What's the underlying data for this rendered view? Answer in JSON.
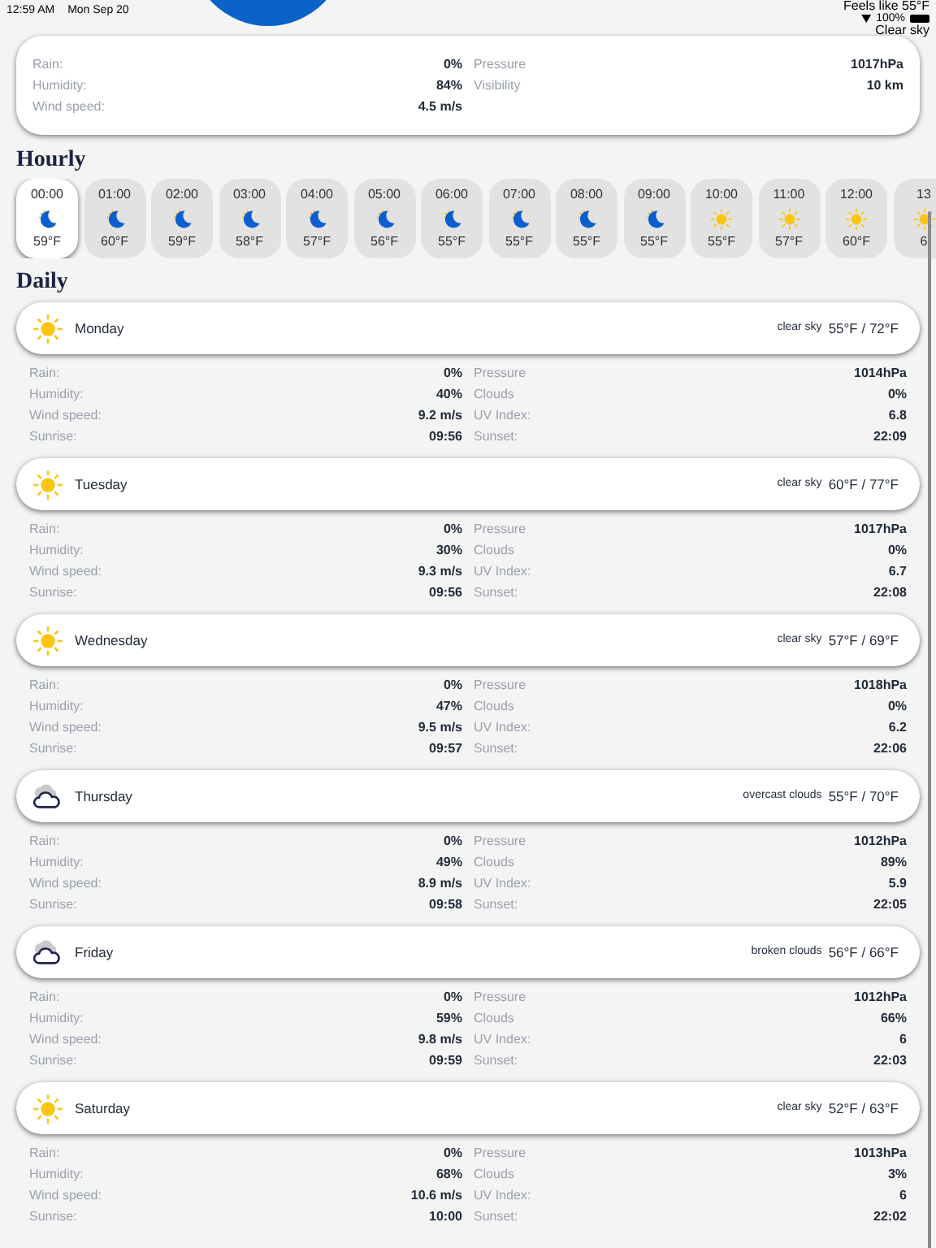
{
  "status_bar": {
    "time": "12:59 AM",
    "date": "Mon Sep 20",
    "battery": "100%"
  },
  "current": {
    "feels_like": "Feels like 55°F",
    "description": "Clear sky",
    "details_left": [
      {
        "label": "Rain:",
        "value": "0%"
      },
      {
        "label": "Humidity:",
        "value": "84%"
      },
      {
        "label": "Wind speed:",
        "value": "4.5 m/s"
      }
    ],
    "details_right": [
      {
        "label": "Pressure",
        "value": "1017hPa"
      },
      {
        "label": "Visibility",
        "value": "10 km"
      }
    ]
  },
  "hourly": {
    "title": "Hourly",
    "items": [
      {
        "time": "00:00",
        "kind": "moon",
        "temp": "59°F",
        "selected": true
      },
      {
        "time": "01:00",
        "kind": "moon",
        "temp": "60°F",
        "selected": false
      },
      {
        "time": "02:00",
        "kind": "moon",
        "temp": "59°F",
        "selected": false
      },
      {
        "time": "03:00",
        "kind": "moon",
        "temp": "58°F",
        "selected": false
      },
      {
        "time": "04:00",
        "kind": "moon",
        "temp": "57°F",
        "selected": false
      },
      {
        "time": "05:00",
        "kind": "moon",
        "temp": "56°F",
        "selected": false
      },
      {
        "time": "06:00",
        "kind": "moon",
        "temp": "55°F",
        "selected": false
      },
      {
        "time": "07:00",
        "kind": "moon",
        "temp": "55°F",
        "selected": false
      },
      {
        "time": "08:00",
        "kind": "moon",
        "temp": "55°F",
        "selected": false
      },
      {
        "time": "09:00",
        "kind": "moon",
        "temp": "55°F",
        "selected": false
      },
      {
        "time": "10:00",
        "kind": "sun",
        "temp": "55°F",
        "selected": false
      },
      {
        "time": "11:00",
        "kind": "sun",
        "temp": "57°F",
        "selected": false
      },
      {
        "time": "12:00",
        "kind": "sun",
        "temp": "60°F",
        "selected": false
      },
      {
        "time": "13",
        "kind": "sun",
        "temp": "6",
        "selected": false
      }
    ]
  },
  "daily": {
    "title": "Daily",
    "days": [
      {
        "name": "Monday",
        "kind": "sun",
        "description": "clear sky",
        "temps": "55°F / 72°F",
        "details_left": [
          {
            "label": "Rain:",
            "value": "0%"
          },
          {
            "label": "Humidity:",
            "value": "40%"
          },
          {
            "label": "Wind speed:",
            "value": "9.2 m/s"
          },
          {
            "label": "Sunrise:",
            "value": "09:56"
          }
        ],
        "details_right": [
          {
            "label": "Pressure",
            "value": "1014hPa"
          },
          {
            "label": "Clouds",
            "value": "0%"
          },
          {
            "label": "UV Index:",
            "value": "6.8"
          },
          {
            "label": "Sunset:",
            "value": "22:09"
          }
        ]
      },
      {
        "name": "Tuesday",
        "kind": "sun",
        "description": "clear sky",
        "temps": "60°F / 77°F",
        "details_left": [
          {
            "label": "Rain:",
            "value": "0%"
          },
          {
            "label": "Humidity:",
            "value": "30%"
          },
          {
            "label": "Wind speed:",
            "value": "9.3 m/s"
          },
          {
            "label": "Sunrise:",
            "value": "09:56"
          }
        ],
        "details_right": [
          {
            "label": "Pressure",
            "value": "1017hPa"
          },
          {
            "label": "Clouds",
            "value": "0%"
          },
          {
            "label": "UV Index:",
            "value": "6.7"
          },
          {
            "label": "Sunset:",
            "value": "22:08"
          }
        ]
      },
      {
        "name": "Wednesday",
        "kind": "sun",
        "description": "clear sky",
        "temps": "57°F / 69°F",
        "details_left": [
          {
            "label": "Rain:",
            "value": "0%"
          },
          {
            "label": "Humidity:",
            "value": "47%"
          },
          {
            "label": "Wind speed:",
            "value": "9.5 m/s"
          },
          {
            "label": "Sunrise:",
            "value": "09:57"
          }
        ],
        "details_right": [
          {
            "label": "Pressure",
            "value": "1018hPa"
          },
          {
            "label": "Clouds",
            "value": "0%"
          },
          {
            "label": "UV Index:",
            "value": "6.2"
          },
          {
            "label": "Sunset:",
            "value": "22:06"
          }
        ]
      },
      {
        "name": "Thursday",
        "kind": "cloud",
        "description": "overcast clouds",
        "temps": "55°F / 70°F",
        "details_left": [
          {
            "label": "Rain:",
            "value": "0%"
          },
          {
            "label": "Humidity:",
            "value": "49%"
          },
          {
            "label": "Wind speed:",
            "value": "8.9 m/s"
          },
          {
            "label": "Sunrise:",
            "value": "09:58"
          }
        ],
        "details_right": [
          {
            "label": "Pressure",
            "value": "1012hPa"
          },
          {
            "label": "Clouds",
            "value": "89%"
          },
          {
            "label": "UV Index:",
            "value": "5.9"
          },
          {
            "label": "Sunset:",
            "value": "22:05"
          }
        ]
      },
      {
        "name": "Friday",
        "kind": "cloud",
        "description": "broken clouds",
        "temps": "56°F / 66°F",
        "details_left": [
          {
            "label": "Rain:",
            "value": "0%"
          },
          {
            "label": "Humidity:",
            "value": "59%"
          },
          {
            "label": "Wind speed:",
            "value": "9.8 m/s"
          },
          {
            "label": "Sunrise:",
            "value": "09:59"
          }
        ],
        "details_right": [
          {
            "label": "Pressure",
            "value": "1012hPa"
          },
          {
            "label": "Clouds",
            "value": "66%"
          },
          {
            "label": "UV Index:",
            "value": "6"
          },
          {
            "label": "Sunset:",
            "value": "22:03"
          }
        ]
      },
      {
        "name": "Saturday",
        "kind": "sun",
        "description": "clear sky",
        "temps": "52°F / 63°F",
        "details_left": [
          {
            "label": "Rain:",
            "value": "0%"
          },
          {
            "label": "Humidity:",
            "value": "68%"
          },
          {
            "label": "Wind speed:",
            "value": "10.6 m/s"
          },
          {
            "label": "Sunrise:",
            "value": "10:00"
          }
        ],
        "details_right": [
          {
            "label": "Pressure",
            "value": "1013hPa"
          },
          {
            "label": "Clouds",
            "value": "3%"
          },
          {
            "label": "UV Index:",
            "value": "6"
          },
          {
            "label": "Sunset:",
            "value": "22:02"
          }
        ]
      }
    ]
  }
}
